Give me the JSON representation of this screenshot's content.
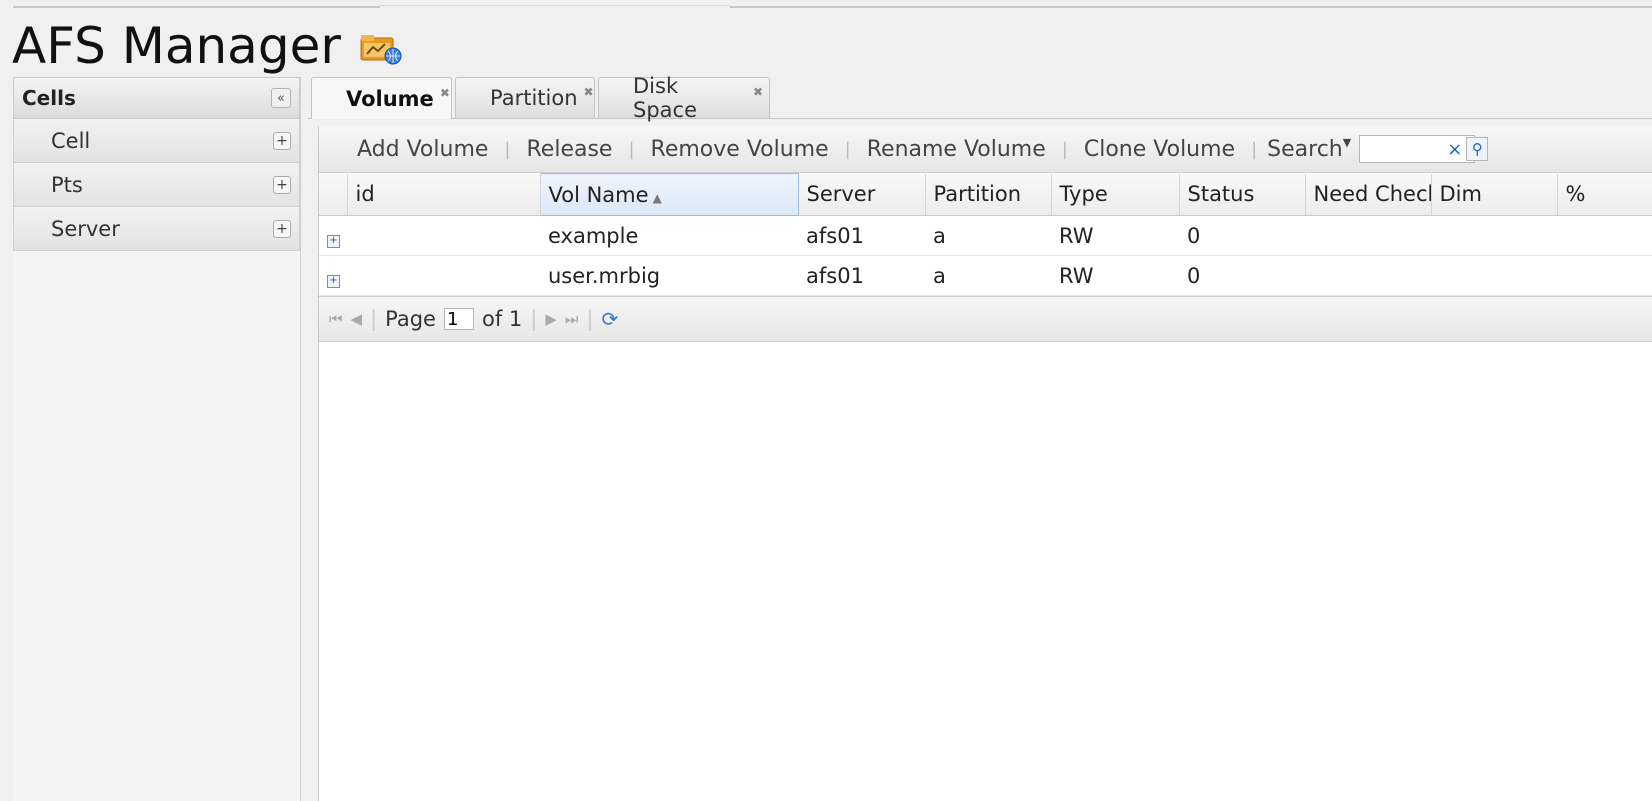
{
  "app": {
    "title": "AFS Manager",
    "logo_icon": "folder-network-icon"
  },
  "sidebar": {
    "title": "Cells",
    "collapse_glyph": "«",
    "items": [
      {
        "label": "Cell",
        "expand_glyph": "+"
      },
      {
        "label": "Pts",
        "expand_glyph": "+"
      },
      {
        "label": "Server",
        "expand_glyph": "+"
      }
    ]
  },
  "tabs": [
    {
      "label": "Volume",
      "active": true
    },
    {
      "label": "Partition",
      "active": false
    },
    {
      "label": "Disk Space",
      "active": false
    }
  ],
  "toolbar": {
    "add": "Add Volume",
    "release": "Release",
    "remove": "Remove Volume",
    "rename": "Rename Volume",
    "clone": "Clone Volume",
    "search": "Search",
    "search_value": ""
  },
  "grid": {
    "columns": [
      "",
      "id",
      "Vol Name",
      "Server",
      "Partition",
      "Type",
      "Status",
      "Need Check",
      "Dim",
      "%"
    ],
    "sorted_column": "Vol Name",
    "sort_direction": "asc",
    "rows": [
      {
        "id": "",
        "vol_name": "example",
        "server": "afs01",
        "partition": "a",
        "type": "RW",
        "status": "0",
        "need_check": "",
        "dim": "",
        "pct": ""
      },
      {
        "id": "",
        "vol_name": "user.mrbig",
        "server": "afs01",
        "partition": "a",
        "type": "RW",
        "status": "0",
        "need_check": "",
        "dim": "",
        "pct": ""
      }
    ]
  },
  "pager": {
    "page_label": "Page",
    "page_value": "1",
    "of_label": "of 1"
  },
  "colors": {
    "accent": "#1d63c9",
    "sorted_header": "#dce8f7"
  }
}
